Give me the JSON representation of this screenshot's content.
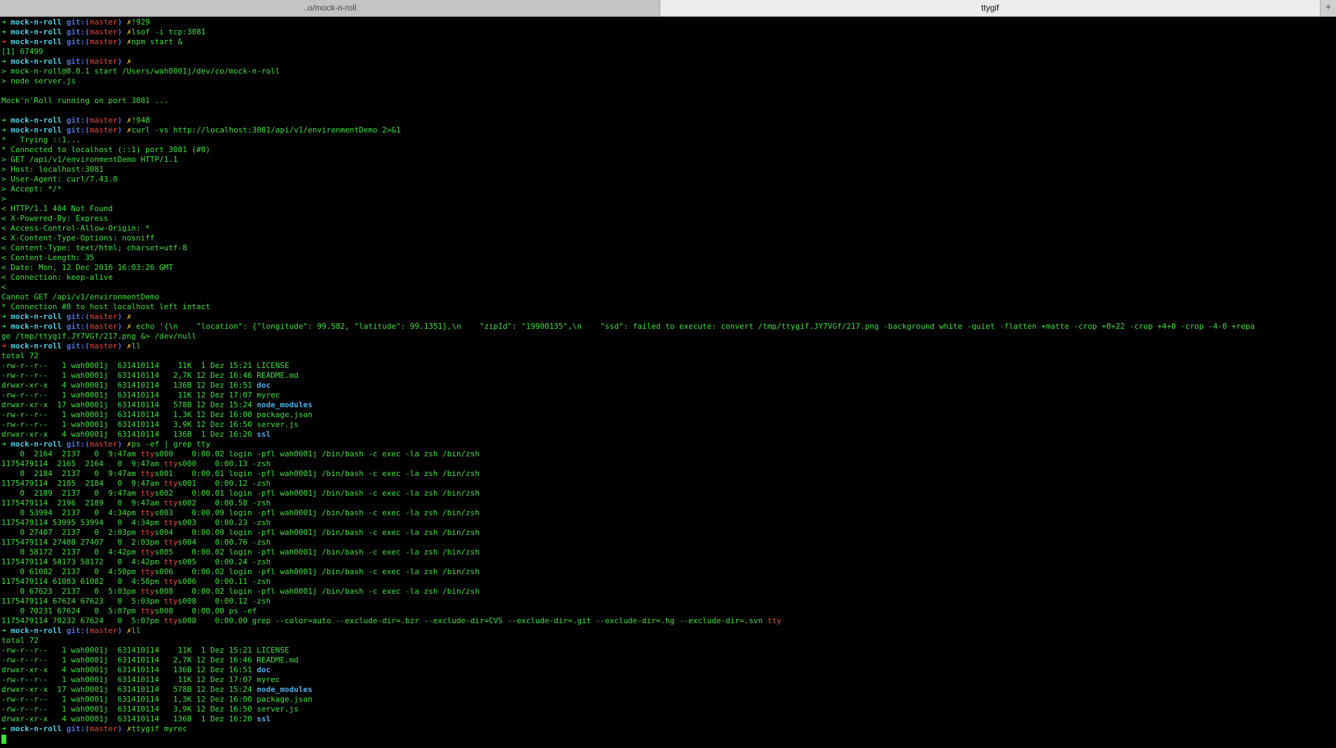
{
  "tabs": [
    {
      "label": "..o/mock-n-roll",
      "active": false
    },
    {
      "label": "ttygif",
      "active": true
    }
  ],
  "new_tab_label": "+",
  "prompt": {
    "arrow": "➜",
    "dir": "mock-n-roll",
    "git": "git:(",
    "branch": "master",
    "git_close": ")",
    "dirty": "✗"
  },
  "colors": {
    "green": "#3ee03e",
    "red": "#e8483b",
    "cyan": "#4fcfe0",
    "blue": "#4f6fe8",
    "yellow": "#e8c63b"
  },
  "lines": [
    {
      "t": "p",
      "cmd": "!929"
    },
    {
      "t": "p",
      "cmd": "lsof -i tcp:3081"
    },
    {
      "t": "p",
      "err": true,
      "cmd": "npm start &"
    },
    {
      "t": "o",
      "text": "[1] 67499"
    },
    {
      "t": "p",
      "cmd": ""
    },
    {
      "t": "o",
      "text": "> mock-n-roll@0.0.1 start /Users/wah0001j/dev/co/mock-n-roll"
    },
    {
      "t": "o",
      "text": "> node server.js"
    },
    {
      "t": "o",
      "text": ""
    },
    {
      "t": "o",
      "text": "Mock'n'Roll running on port 3081 ..."
    },
    {
      "t": "o",
      "text": ""
    },
    {
      "t": "p",
      "cmd": "!948"
    },
    {
      "t": "p",
      "cmd": "curl -vs http://localhost:3081/api/v1/environmentDemo 2>&1"
    },
    {
      "t": "o",
      "text": "*   Trying ::1..."
    },
    {
      "t": "o",
      "text": "* Connected to localhost (::1) port 3081 (#0)"
    },
    {
      "t": "o",
      "text": "> GET /api/v1/environmentDemo HTTP/1.1"
    },
    {
      "t": "o",
      "text": "> Host: localhost:3081"
    },
    {
      "t": "o",
      "text": "> User-Agent: curl/7.43.0"
    },
    {
      "t": "o",
      "text": "> Accept: */*"
    },
    {
      "t": "o",
      "text": ">"
    },
    {
      "t": "o",
      "text": "< HTTP/1.1 404 Not Found"
    },
    {
      "t": "o",
      "text": "< X-Powered-By: Express"
    },
    {
      "t": "o",
      "text": "< Access-Control-Allow-Origin: *"
    },
    {
      "t": "o",
      "text": "< X-Content-Type-Options: nosniff"
    },
    {
      "t": "o",
      "text": "< Content-Type: text/html; charset=utf-8"
    },
    {
      "t": "o",
      "text": "< Content-Length: 35"
    },
    {
      "t": "o",
      "text": "< Date: Mon, 12 Dec 2016 16:03:26 GMT"
    },
    {
      "t": "o",
      "text": "< Connection: keep-alive"
    },
    {
      "t": "o",
      "text": "<"
    },
    {
      "t": "o",
      "text": "Cannot GET /api/v1/environmentDemo"
    },
    {
      "t": "o",
      "text": "* Connection #0 to host localhost left intact"
    },
    {
      "t": "p",
      "cmd": ""
    },
    {
      "t": "p",
      "cmd": " echo '{\\n    \"location\": {\"longitude\": 99.582, \"latitude\": 99.1351},\\n    \"zipId\": \"19900135\",\\n    \"ssd\": failed to execute: convert /tmp/ttygif.JY7VGf/217.png -background white -quiet -flatten +matte -crop +0+22 -crop +4+0 -crop -4-0 +repa"
    },
    {
      "t": "o",
      "text": "ge /tmp/ttygif.JY7VGf/217.png &> /dev/null"
    },
    {
      "t": "p",
      "err": true,
      "cmd": "ll"
    },
    {
      "t": "o",
      "text": "total 72"
    },
    {
      "t": "f",
      "text": "-rw-r--r--   1 wah0001j  631410114    11K  1 Dez 15:21 ",
      "name": "LICENSE"
    },
    {
      "t": "f",
      "text": "-rw-r--r--   1 wah0001j  631410114   2,7K 12 Dez 16:46 ",
      "name": "README.md"
    },
    {
      "t": "f",
      "text": "drwxr-xr-x   4 wah0001j  631410114   136B 12 Dez 16:51 ",
      "name": "doc",
      "dir": true
    },
    {
      "t": "f",
      "text": "-rw-r--r--   1 wah0001j  631410114    11K 12 Dez 17:07 ",
      "name": "myrec"
    },
    {
      "t": "f",
      "text": "drwxr-xr-x  17 wah0001j  631410114   578B 12 Dez 15:24 ",
      "name": "node_modules",
      "dir": true
    },
    {
      "t": "f",
      "text": "-rw-r--r--   1 wah0001j  631410114   1,3K 12 Dez 16:00 ",
      "name": "package.json"
    },
    {
      "t": "f",
      "text": "-rw-r--r--   1 wah0001j  631410114   3,9K 12 Dez 16:50 ",
      "name": "server.js"
    },
    {
      "t": "f",
      "text": "drwxr-xr-x   4 wah0001j  631410114   136B  1 Dez 16:20 ",
      "name": "ssl",
      "dir": true
    },
    {
      "t": "p",
      "cmd": "ps -ef | grep tty"
    },
    {
      "t": "ps",
      "a": "    0  2164  2137   0  9:47am ",
      "b": "s000    0:00.02 login -pfl wah0001j /bin/bash -c exec -la zsh /bin/zsh"
    },
    {
      "t": "ps",
      "a": "1175479114  2165  2164   0  9:47am ",
      "b": "s000    0:00.13 -zsh"
    },
    {
      "t": "ps",
      "a": "    0  2184  2137   0  9:47am ",
      "b": "s001    0:00.01 login -pfl wah0001j /bin/bash -c exec -la zsh /bin/zsh"
    },
    {
      "t": "ps",
      "a": "1175479114  2185  2184   0  9:47am ",
      "b": "s001    0:00.12 -zsh"
    },
    {
      "t": "ps",
      "a": "    0  2189  2137   0  9:47am ",
      "b": "s002    0:00.01 login -pfl wah0001j /bin/bash -c exec -la zsh /bin/zsh"
    },
    {
      "t": "ps",
      "a": "1175479114  2196  2189   0  9:47am ",
      "b": "s002    0:00.58 -zsh"
    },
    {
      "t": "ps",
      "a": "    0 53994  2137   0  4:34pm ",
      "b": "s003    0:00.09 login -pfl wah0001j /bin/bash -c exec -la zsh /bin/zsh"
    },
    {
      "t": "ps",
      "a": "1175479114 53995 53994   0  4:34pm ",
      "b": "s003    0:00.23 -zsh"
    },
    {
      "t": "ps",
      "a": "    0 27407  2137   0  2:03pm ",
      "b": "s004    0:00.09 login -pfl wah0001j /bin/bash -c exec -la zsh /bin/zsh"
    },
    {
      "t": "ps",
      "a": "1175479114 27408 27407   0  2:03pm ",
      "b": "s004    0:00.76 -zsh"
    },
    {
      "t": "ps",
      "a": "    0 58172  2137   0  4:42pm ",
      "b": "s005    0:00.02 login -pfl wah0001j /bin/bash -c exec -la zsh /bin/zsh"
    },
    {
      "t": "ps",
      "a": "1175479114 58173 58172   0  4:42pm ",
      "b": "s005    0:00.24 -zsh"
    },
    {
      "t": "ps",
      "a": "    0 61082  2137   0  4:50pm ",
      "b": "s006    0:00.02 login -pfl wah0001j /bin/bash -c exec -la zsh /bin/zsh"
    },
    {
      "t": "ps",
      "a": "1175479114 61083 61082   0  4:50pm ",
      "b": "s006    0:00.11 -zsh"
    },
    {
      "t": "ps",
      "a": "    0 67623  2137   0  5:03pm ",
      "b": "s008    0:00.02 login -pfl wah0001j /bin/bash -c exec -la zsh /bin/zsh"
    },
    {
      "t": "ps",
      "a": "1175479114 67624 67623   0  5:03pm ",
      "b": "s008    0:00.12 -zsh"
    },
    {
      "t": "ps",
      "a": "    0 70231 67624   0  5:07pm ",
      "b": "s008    0:00.00 ps -ef"
    },
    {
      "t": "ps",
      "a": "1175479114 70232 67624   0  5:07pm ",
      "b": "s008    0:00.00 grep --color=auto --exclude-dir=.bzr --exclude-dir=CVS --exclude-dir=.git --exclude-dir=.hg --exclude-dir=.svn ",
      "tail": "tty"
    },
    {
      "t": "p",
      "cmd": "ll"
    },
    {
      "t": "o",
      "text": "total 72"
    },
    {
      "t": "f",
      "text": "-rw-r--r--   1 wah0001j  631410114    11K  1 Dez 15:21 ",
      "name": "LICENSE"
    },
    {
      "t": "f",
      "text": "-rw-r--r--   1 wah0001j  631410114   2,7K 12 Dez 16:46 ",
      "name": "README.md"
    },
    {
      "t": "f",
      "text": "drwxr-xr-x   4 wah0001j  631410114   136B 12 Dez 16:51 ",
      "name": "doc",
      "dir": true
    },
    {
      "t": "f",
      "text": "-rw-r--r--   1 wah0001j  631410114    11K 12 Dez 17:07 ",
      "name": "myrec"
    },
    {
      "t": "f",
      "text": "drwxr-xr-x  17 wah0001j  631410114   578B 12 Dez 15:24 ",
      "name": "node_modules",
      "dir": true
    },
    {
      "t": "f",
      "text": "-rw-r--r--   1 wah0001j  631410114   1,3K 12 Dez 16:00 ",
      "name": "package.json"
    },
    {
      "t": "f",
      "text": "-rw-r--r--   1 wah0001j  631410114   3,9K 12 Dez 16:50 ",
      "name": "server.js"
    },
    {
      "t": "f",
      "text": "drwxr-xr-x   4 wah0001j  631410114   136B  1 Dez 16:20 ",
      "name": "ssl",
      "dir": true
    },
    {
      "t": "p",
      "cmd": "ttygif myrec"
    },
    {
      "t": "c"
    }
  ],
  "tty_word": "tty"
}
